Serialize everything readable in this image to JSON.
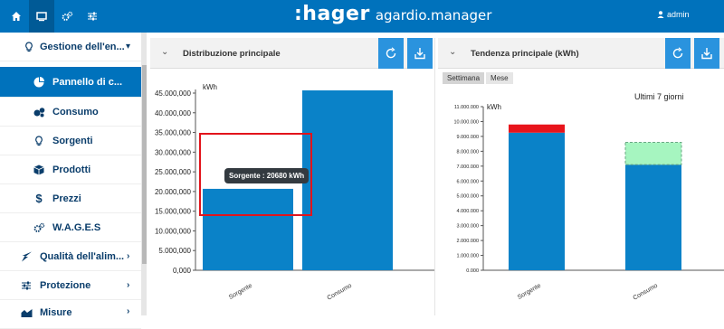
{
  "topbar": {
    "icons": [
      "home-icon",
      "monitor-icon",
      "gears-icon",
      "sliders-icon"
    ],
    "brand": ":hager",
    "app_name": "agardio.manager",
    "user": "admin",
    "accent": "#0072bc"
  },
  "sidebar": {
    "items": [
      {
        "label": "Gestione dell'en...",
        "icon": "bulb-icon",
        "chevron": "▾"
      },
      {
        "label": "Pannello di c...",
        "icon": "pie-chart-icon",
        "active": true
      },
      {
        "label": "Consumo",
        "icon": "bubbles-icon"
      },
      {
        "label": "Sorgenti",
        "icon": "bulb-icon"
      },
      {
        "label": "Prodotti",
        "icon": "cube-icon"
      },
      {
        "label": "Prezzi",
        "icon": "dollar-icon"
      },
      {
        "label": "W.A.G.E.S",
        "icon": "gears-icon"
      },
      {
        "label": "Qualità dell'alim...",
        "icon": "lightning-icon",
        "chevron": "›"
      },
      {
        "label": "Protezione",
        "icon": "sliders-icon",
        "chevron": "›"
      },
      {
        "label": "Misure",
        "icon": "area-chart-icon",
        "chevron": "›"
      }
    ]
  },
  "left_panel": {
    "title": "Distribuzione principale",
    "tooltip": "Sorgente : 20680 kWh"
  },
  "right_panel": {
    "title": "Tendenza principale (kWh)",
    "tabs": [
      "Settimana",
      "Mese"
    ],
    "period": "Ultimi 7 giorni"
  },
  "chart_data": [
    {
      "type": "bar",
      "title": "",
      "ylabel": "kWh",
      "categories": [
        "Sorgente",
        "Consumo"
      ],
      "values": [
        20680,
        46000
      ],
      "ylim": [
        0,
        45000
      ],
      "yticks": [
        "0,000",
        "5.000,000",
        "10.000,000",
        "15.000,000",
        "20.000,000",
        "25.000,000",
        "30.000,000",
        "35.000,000",
        "40.000,000",
        "45.000,000"
      ],
      "color": "#0a82c8"
    },
    {
      "type": "bar",
      "title": "",
      "ylabel": "kWh",
      "categories": [
        "Sorgente",
        "Consumo"
      ],
      "series": [
        {
          "values": [
            9250,
            7100
          ],
          "color": "#0a82c8"
        },
        {
          "values": [
            550,
            0
          ],
          "color": "#e8141b"
        },
        {
          "values": [
            0,
            1500
          ],
          "color": "#a6f5c0"
        }
      ],
      "ylim": [
        0,
        11000
      ],
      "yticks": [
        "0.000",
        "1.000.000",
        "2.000.000",
        "3.000.000",
        "4.000.000",
        "5.000.000",
        "6.000.000",
        "7.000.000",
        "8.000.000",
        "9.000.000",
        "10.000.000",
        "11.000.000"
      ]
    }
  ]
}
